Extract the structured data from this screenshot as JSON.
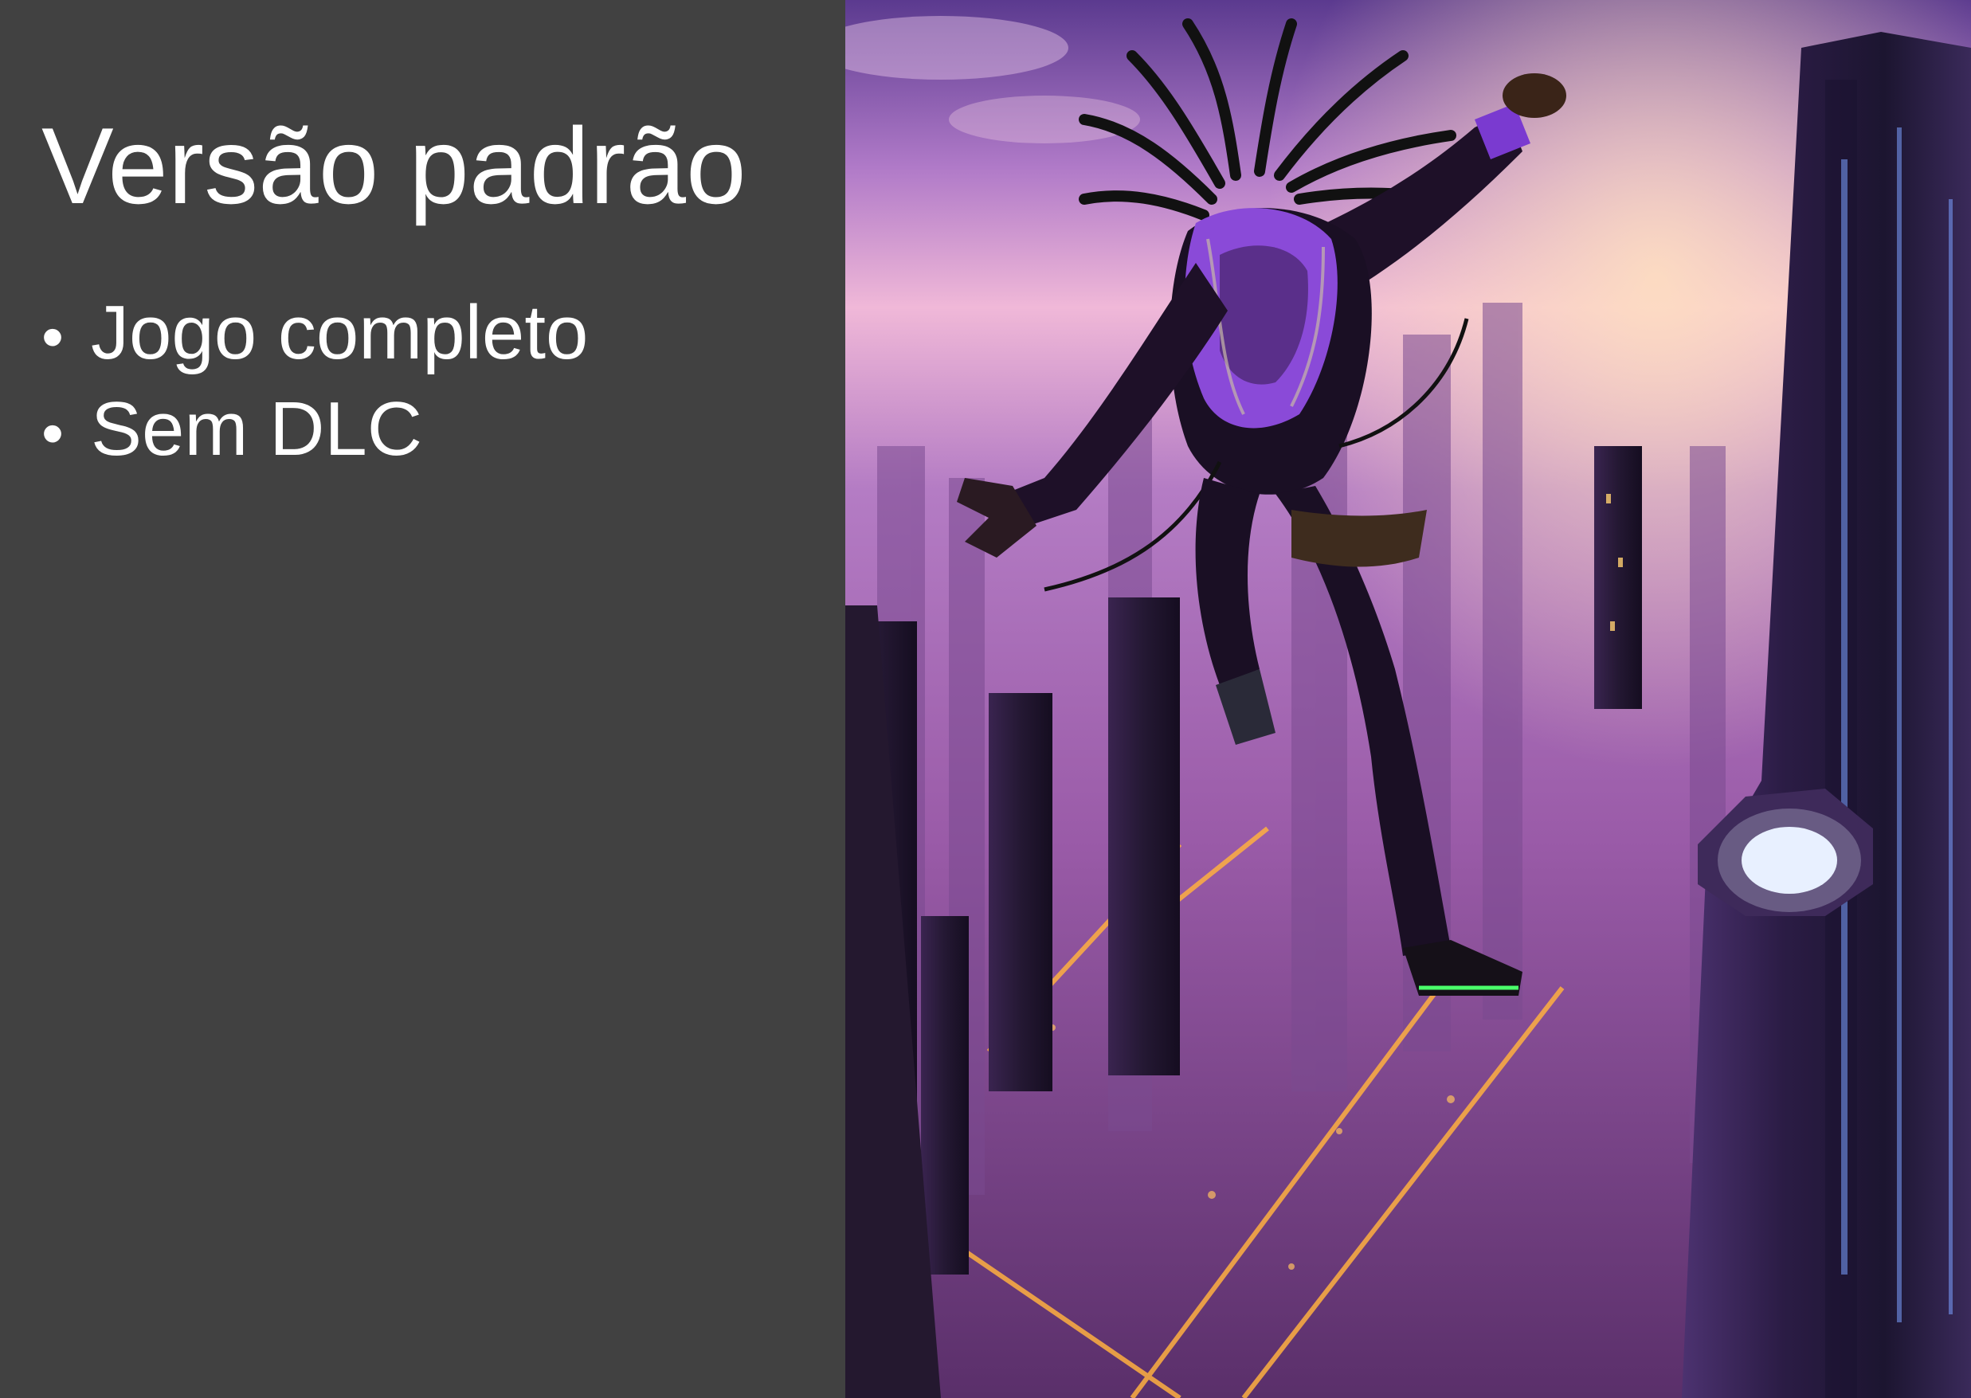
{
  "slide": {
    "title": "Versão padrão",
    "features": [
      {
        "bullet": "•",
        "label": "Jogo completo"
      },
      {
        "bullet": "•",
        "label": "Sem DLC"
      }
    ]
  },
  "artwork": {
    "subject": "cover-art-jumper-over-city-icon",
    "colors": {
      "panel": "#414141",
      "sky_top": "#5b3a8f",
      "sky_glow": "#f0b8d8",
      "haze": "#9a5ba8",
      "building": "#2a1a35",
      "street_light": "#ffb040",
      "suit_accent": "#8a4ad8"
    }
  }
}
